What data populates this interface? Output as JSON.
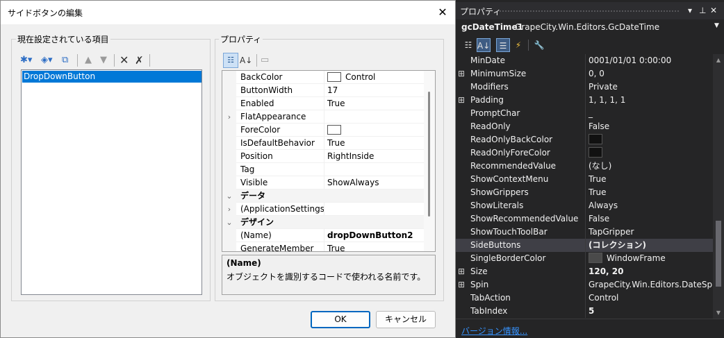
{
  "dialog": {
    "title": "サイドボタンの編集",
    "close_glyph": "✕",
    "items_group_label": "現在設定されている項目",
    "props_group_label": "プロパティ",
    "items": [
      "DropDownButton"
    ],
    "ok_label": "OK",
    "cancel_label": "キャンセル",
    "grid_rows": [
      {
        "kind": "prop",
        "name": "BackColor",
        "value": "Control",
        "swatch": "#ffffff",
        "gutter": ""
      },
      {
        "kind": "prop",
        "name": "ButtonWidth",
        "value": "17",
        "gutter": ""
      },
      {
        "kind": "prop",
        "name": "Enabled",
        "value": "True",
        "gutter": ""
      },
      {
        "kind": "prop",
        "name": "FlatAppearance",
        "value": "",
        "gutter": "›"
      },
      {
        "kind": "prop",
        "name": "ForeColor",
        "value": "",
        "swatch": "#ffffff",
        "gutter": ""
      },
      {
        "kind": "prop",
        "name": "IsDefaultBehavior",
        "value": "True",
        "gutter": ""
      },
      {
        "kind": "prop",
        "name": "Position",
        "value": "RightInside",
        "gutter": ""
      },
      {
        "kind": "prop",
        "name": "Tag",
        "value": "",
        "gutter": ""
      },
      {
        "kind": "prop",
        "name": "Visible",
        "value": "ShowAlways",
        "gutter": ""
      },
      {
        "kind": "cat",
        "name": "データ",
        "value": "",
        "gutter": "⌄"
      },
      {
        "kind": "prop",
        "name": "(ApplicationSettings)",
        "value": "",
        "gutter": "›"
      },
      {
        "kind": "cat",
        "name": "デザイン",
        "value": "",
        "gutter": "⌄"
      },
      {
        "kind": "prop",
        "name": "(Name)",
        "value": "dropDownButton2",
        "bold": true,
        "gutter": ""
      },
      {
        "kind": "prop",
        "name": "GenerateMember",
        "value": "True",
        "gutter": ""
      }
    ],
    "desc_title": "(Name)",
    "desc_text": "オブジェクトを識別するコードで使われる名前です。"
  },
  "props": {
    "title": "プロパティ",
    "title_controls": [
      "▾",
      "⊥",
      "✕"
    ],
    "object_name": "gcDateTime1",
    "object_type": "GrapeCity.Win.Editors.GcDateTime",
    "rows": [
      {
        "name": "MinDate",
        "value": "0001/01/01 0:00:00",
        "expand": ""
      },
      {
        "name": "MinimumSize",
        "value": "0, 0",
        "expand": "⊞"
      },
      {
        "name": "Modifiers",
        "value": "Private",
        "expand": ""
      },
      {
        "name": "Padding",
        "value": "1, 1, 1, 1",
        "expand": "⊞"
      },
      {
        "name": "PromptChar",
        "value": "_",
        "expand": ""
      },
      {
        "name": "ReadOnly",
        "value": "False",
        "expand": ""
      },
      {
        "name": "ReadOnlyBackColor",
        "value": "",
        "swatch": "black",
        "expand": ""
      },
      {
        "name": "ReadOnlyForeColor",
        "value": "",
        "swatch": "black",
        "expand": ""
      },
      {
        "name": "RecommendedValue",
        "value": "(なし)",
        "expand": ""
      },
      {
        "name": "ShowContextMenu",
        "value": "True",
        "expand": ""
      },
      {
        "name": "ShowGrippers",
        "value": "True",
        "expand": ""
      },
      {
        "name": "ShowLiterals",
        "value": "Always",
        "expand": ""
      },
      {
        "name": "ShowRecommendedValue",
        "value": "False",
        "expand": ""
      },
      {
        "name": "ShowTouchToolBar",
        "value": "TapGripper",
        "expand": ""
      },
      {
        "name": "SideButtons",
        "value": "(コレクション)",
        "bold": true,
        "selected": true,
        "expand": ""
      },
      {
        "name": "SingleBorderColor",
        "value": "WindowFrame",
        "swatch": "gray",
        "expand": ""
      },
      {
        "name": "Size",
        "value": "120, 20",
        "bold": true,
        "expand": "⊞"
      },
      {
        "name": "Spin",
        "value": "GrapeCity.Win.Editors.DateSpin",
        "expand": "⊞"
      },
      {
        "name": "TabAction",
        "value": "Control",
        "expand": ""
      },
      {
        "name": "TabIndex",
        "value": "5",
        "bold": true,
        "expand": ""
      }
    ],
    "footer_link": "バージョン情報..."
  }
}
